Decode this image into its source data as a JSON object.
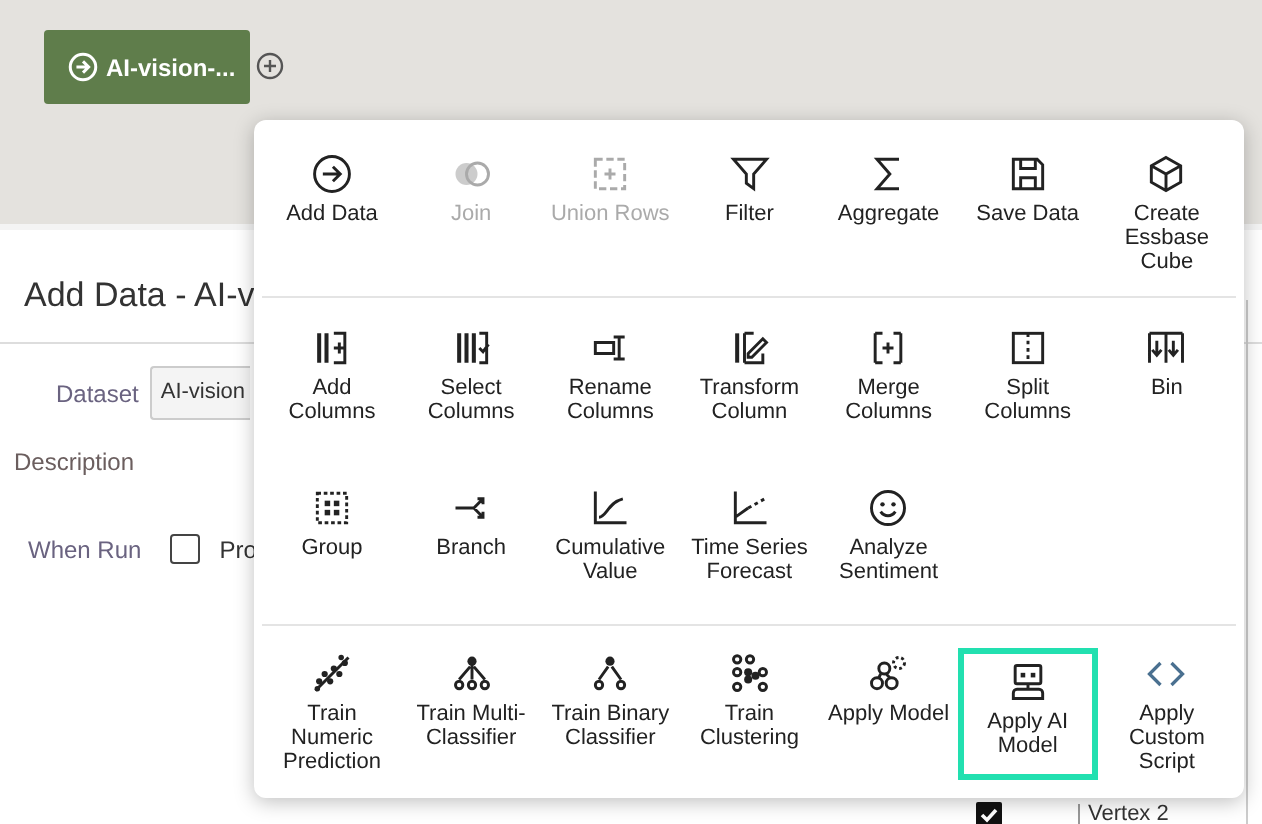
{
  "node": {
    "label": "AI-vision-..."
  },
  "panel": {
    "title": "Add Data - AI-v",
    "fields": [
      {
        "kind": "select",
        "label": "Dataset",
        "value": "AI-vision"
      },
      {
        "kind": "text",
        "label": "Description"
      },
      {
        "kind": "checkbox",
        "label": "When Run",
        "checked": false,
        "text": "Pro"
      }
    ]
  },
  "table": {
    "rows": [
      {
        "checked": true,
        "text": "Vertex 2"
      }
    ]
  },
  "menu": {
    "sections": [
      {
        "items": [
          {
            "label": "Add Data",
            "disabled": false,
            "selected": false
          },
          {
            "label": "Join",
            "disabled": true,
            "selected": false
          },
          {
            "label": "Union Rows",
            "disabled": true,
            "selected": false
          },
          {
            "label": "Filter",
            "disabled": false,
            "selected": false
          },
          {
            "label": "Aggregate",
            "disabled": false,
            "selected": false
          },
          {
            "label": "Save Data",
            "disabled": false,
            "selected": false
          },
          {
            "label": "Create Essbase Cube",
            "disabled": false,
            "selected": false
          }
        ]
      },
      {
        "items": [
          {
            "label": "Add Columns",
            "disabled": false,
            "selected": false
          },
          {
            "label": "Select Columns",
            "disabled": false,
            "selected": false
          },
          {
            "label": "Rename Columns",
            "disabled": false,
            "selected": false
          },
          {
            "label": "Transform Column",
            "disabled": false,
            "selected": false
          },
          {
            "label": "Merge Columns",
            "disabled": false,
            "selected": false
          },
          {
            "label": "Split Columns",
            "disabled": false,
            "selected": false
          },
          {
            "label": "Bin",
            "disabled": false,
            "selected": false
          },
          {
            "label": "Group",
            "disabled": false,
            "selected": false
          },
          {
            "label": "Branch",
            "disabled": false,
            "selected": false
          },
          {
            "label": "Cumulative Value",
            "disabled": false,
            "selected": false
          },
          {
            "label": "Time Series Forecast",
            "disabled": false,
            "selected": false
          },
          {
            "label": "Analyze Sentiment",
            "disabled": false,
            "selected": false
          }
        ]
      },
      {
        "items": [
          {
            "label": "Train Numeric Prediction",
            "disabled": false,
            "selected": false
          },
          {
            "label": "Train Multi-Classifier",
            "disabled": false,
            "selected": false
          },
          {
            "label": "Train Binary Classifier",
            "disabled": false,
            "selected": false
          },
          {
            "label": "Train Clustering",
            "disabled": false,
            "selected": false
          },
          {
            "label": "Apply Model",
            "disabled": false,
            "selected": false
          },
          {
            "label": "Apply AI Model",
            "disabled": false,
            "selected": true
          },
          {
            "label": "Apply Custom Script",
            "disabled": false,
            "selected": false
          }
        ]
      }
    ]
  }
}
